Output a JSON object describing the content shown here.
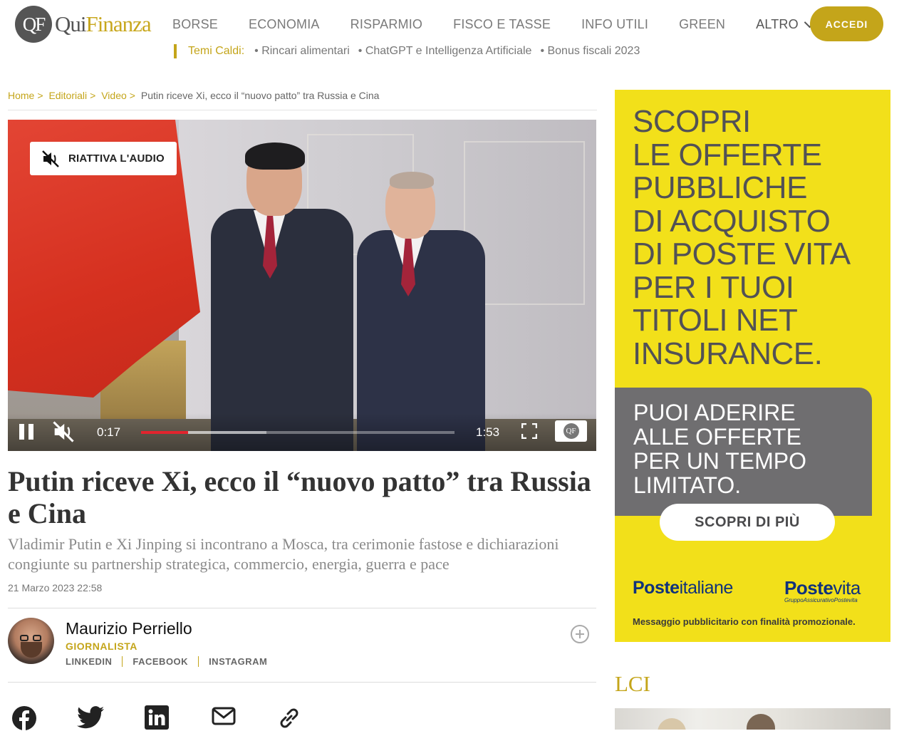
{
  "header": {
    "logo_mark": "QF",
    "logo_part1": "Qui",
    "logo_part2": "Finanza",
    "nav": [
      "BORSE",
      "ECONOMIA",
      "RISPARMIO",
      "FISCO E TASSE",
      "INFO UTILI",
      "GREEN"
    ],
    "altro": "ALTRO",
    "login": "ACCEDI",
    "hot_topics_label": "Temi Caldi:",
    "hot_topics": [
      "• Rincari alimentari",
      "• ChatGPT e Intelligenza Artificiale",
      "• Bonus fiscali 2023"
    ]
  },
  "breadcrumb": {
    "items": [
      "Home",
      "Editoriali",
      "Video"
    ],
    "separator": ">",
    "current": "Putin riceve Xi, ecco il “nuovo patto” tra Russia e Cina"
  },
  "video": {
    "unmute_label": "RIATTIVA L'AUDIO",
    "current_time": "0:17",
    "duration": "1:53",
    "played_fraction": 0.15,
    "buffered_fraction": 0.4,
    "logo_mark": "QF"
  },
  "article": {
    "title": "Putin riceve Xi, ecco il “nuovo patto” tra Russia e Cina",
    "subtitle": "Vladimir Putin e Xi Jinping si incontrano a Mosca, tra cerimonie fastose e dichiarazioni congiunte su partnership strategica, commercio, energia, guerra e pace",
    "date": "21 Marzo 2023 22:58"
  },
  "author": {
    "name": "Maurizio Perriello",
    "role": "GIORNALISTA",
    "links": [
      "LINKEDIN",
      "FACEBOOK",
      "INSTAGRAM"
    ]
  },
  "share": [
    "facebook-icon",
    "twitter-icon",
    "linkedin-icon",
    "mail-icon",
    "link-icon"
  ],
  "ad": {
    "headline": [
      "SCOPRI",
      "LE OFFERTE",
      "PUBBLICHE",
      "DI ACQUISTO",
      "DI POSTE VITA",
      "PER I TUOI",
      "TITOLI NET",
      "INSURANCE."
    ],
    "box_text": [
      "PUOI ADERIRE",
      "ALLE OFFERTE",
      "PER UN TEMPO",
      "LIMITATO."
    ],
    "cta": "SCOPRI DI PIÙ",
    "brand1_a": "Poste",
    "brand1_b": "italiane",
    "brand2_a": "Poste",
    "brand2_b": "vita",
    "brand2_sub": "GruppoAssicurativoPostevita",
    "footer": "Messaggio pubblicitario con finalità promozionale.",
    "bg_color": "#f2e01a"
  },
  "sidebar": {
    "section_title": "LCI"
  },
  "colors": {
    "accent": "#c4a51a",
    "progress": "#e1242e"
  }
}
